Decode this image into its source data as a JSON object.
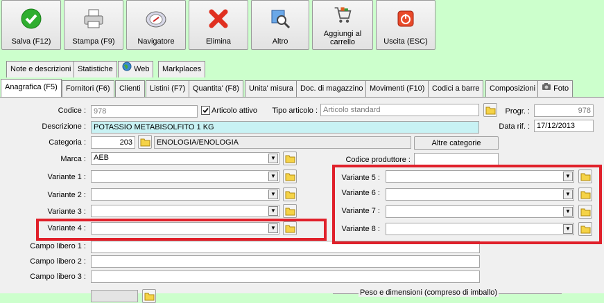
{
  "toolbar": {
    "save": "Salva (F12)",
    "print": "Stampa (F9)",
    "navigator": "Navigatore",
    "delete": "Elimina",
    "other": "Altro",
    "add_cart": "Aggiungi al carrello",
    "exit": "Uscita (ESC)"
  },
  "tabs_top": [
    "Note e descrizioni",
    "Statistiche",
    "Web",
    "Markplaces"
  ],
  "tabs_main": [
    "Anagrafica (F5)",
    "Fornitori (F6)",
    "Clienti",
    "Listini (F7)",
    "Quantita' (F8)",
    "Unita' misura",
    "Doc. di magazzino",
    "Movimenti (F10)",
    "Codici a barre",
    "Composizioni",
    "Foto"
  ],
  "form": {
    "codice_label": "Codice :",
    "codice_value": "978",
    "articolo_attivo_label": "Articolo attivo",
    "articolo_attivo_checked": true,
    "tipo_articolo_label": "Tipo articolo :",
    "tipo_articolo_value": "Articolo standard",
    "progr_label": "Progr. :",
    "progr_value": "978",
    "descrizione_label": "Descrizione :",
    "descrizione_value": "POTASSIO METABISOLFITO   1 KG",
    "data_rif_label": "Data rif. :",
    "data_rif_value": "17/12/2013",
    "categoria_label": "Categoria :",
    "categoria_code": "203",
    "categoria_value": "ENOLOGIA/ENOLOGIA",
    "altre_categorie": "Altre categorie",
    "marca_label": "Marca :",
    "marca_value": "AEB",
    "codice_produttore_label": "Codice produttore :",
    "codice_produttore_value": "",
    "variante_labels": [
      "Variante 1 :",
      "Variante 2 :",
      "Variante 3 :",
      "Variante 4 :",
      "Variante 5 :",
      "Variante 6 :",
      "Variante 7 :",
      "Variante 8 :"
    ],
    "campo_labels": [
      "Campo libero 1 :",
      "Campo libero 2 :",
      "Campo libero 3 :"
    ],
    "peso_label": "Peso e dimensioni (compreso di imballo)"
  },
  "colors": {
    "background": "#ccffcc",
    "highlight": "#e0202a",
    "descrizione_fill": "#c8f2f4"
  }
}
